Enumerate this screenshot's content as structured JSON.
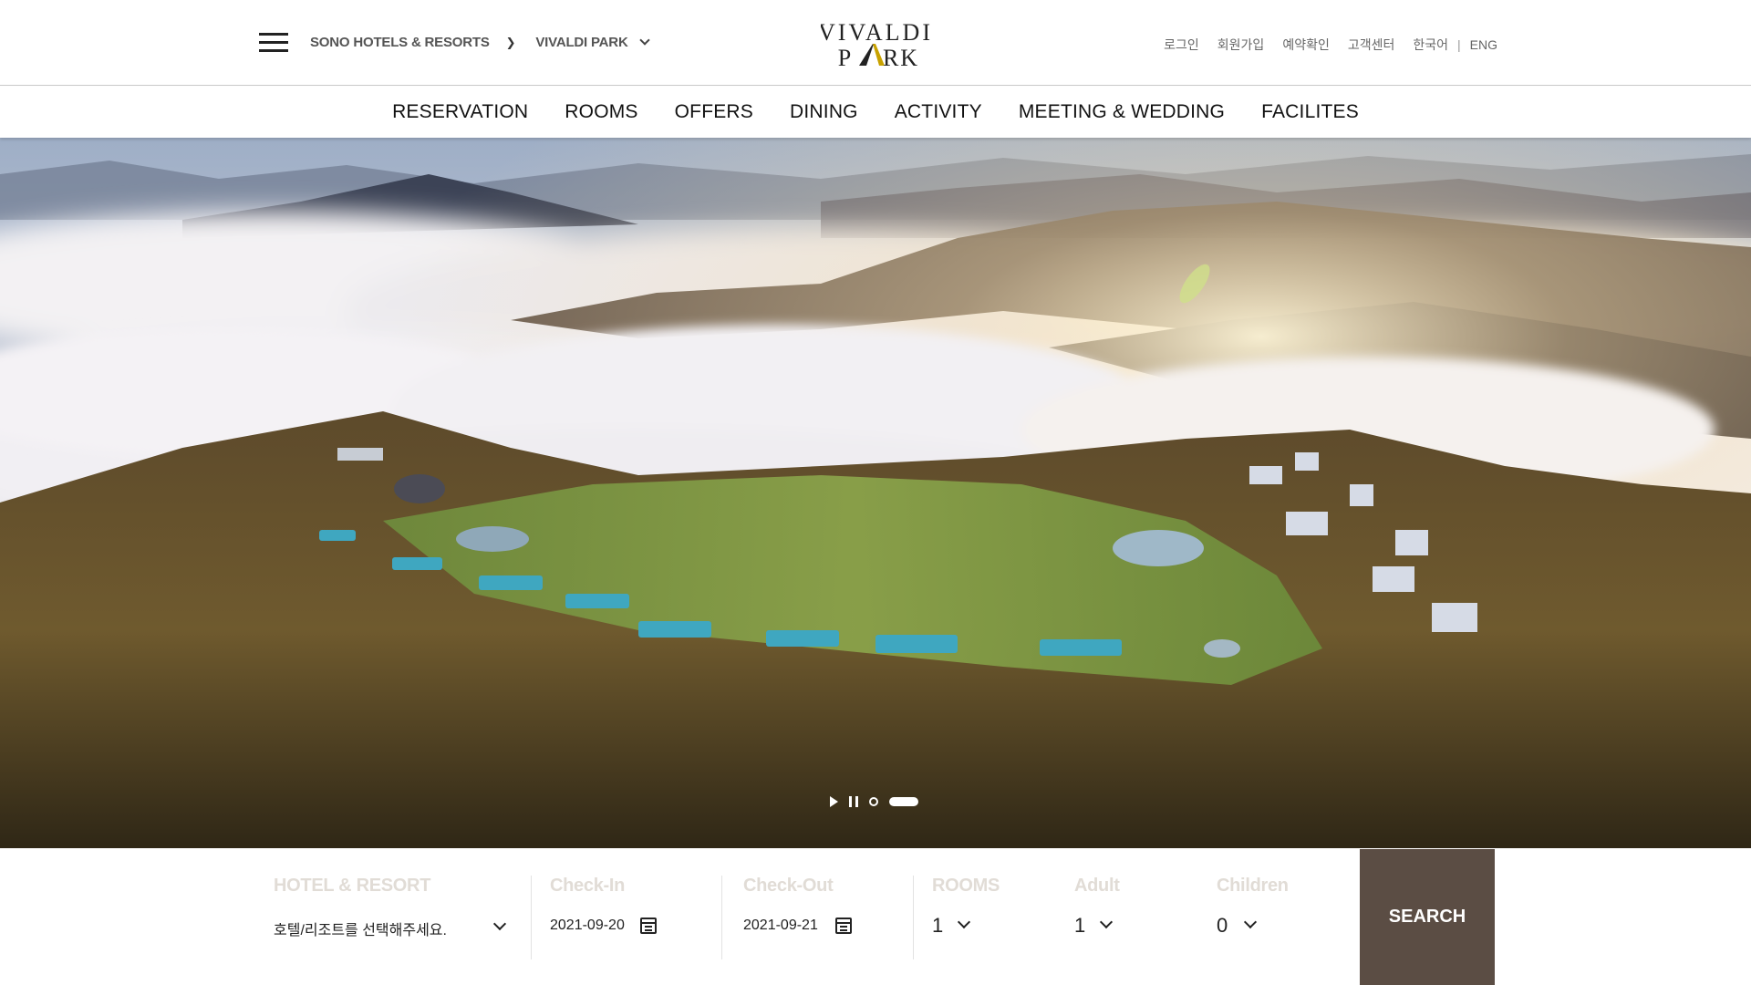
{
  "header": {
    "breadcrumb_root": "SONO HOTELS & RESORTS",
    "breadcrumb_current": "VIVALDI PARK",
    "logo_line1": "VIVALDI",
    "logo_line2_left": "P",
    "logo_line2_right": "RK",
    "utils": {
      "login": "로그인",
      "signup": "회원가입",
      "reservation_check": "예약확인",
      "customer_center": "고객센터",
      "korean": "한국어",
      "english": "ENG"
    }
  },
  "nav": {
    "items": [
      "RESERVATION",
      "ROOMS",
      "OFFERS",
      "DINING",
      "ACTIVITY",
      "MEETING & WEDDING",
      "FACILITES"
    ]
  },
  "hero": {
    "image_desc": "aerial-resort-above-clouds"
  },
  "booking": {
    "hotel_label": "HOTEL & RESORT",
    "hotel_placeholder": "호텔/리조트를 선택해주세요.",
    "checkin_label": "Check-In",
    "checkin_value": "2021-09-20",
    "checkout_label": "Check-Out",
    "checkout_value": "2021-09-21",
    "rooms_label": "ROOMS",
    "rooms_value": "1",
    "adult_label": "Adult",
    "adult_value": "1",
    "children_label": "Children",
    "children_value": "0",
    "search_label": "SEARCH"
  },
  "colors": {
    "accent_brown": "#5b4d44",
    "label_muted": "#e1dcd6",
    "logo_gold": "#c8a200"
  }
}
